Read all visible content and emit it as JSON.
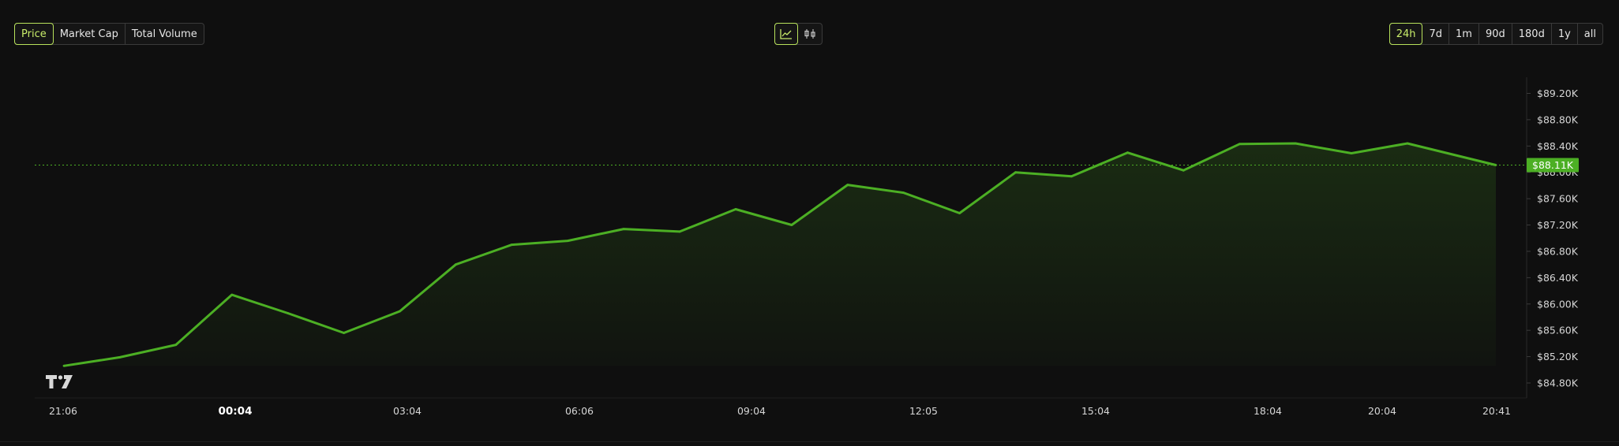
{
  "metric_tabs": {
    "items": [
      "Price",
      "Market Cap",
      "Total Volume"
    ],
    "active": 0
  },
  "chart_type_toggle": {
    "items": [
      "line-chart-icon",
      "candlestick-icon"
    ],
    "active": 0
  },
  "range_tabs": {
    "items": [
      "24h",
      "7d",
      "1m",
      "90d",
      "180d",
      "1y",
      "all"
    ],
    "active": 0
  },
  "colors": {
    "accent": "#b8e25b",
    "line": "#4caf24",
    "current_price_badge": "#4caf24",
    "background": "#0f0f0f"
  },
  "current_price_label": "$88.11K",
  "logo": "TV",
  "chart_data": {
    "type": "area",
    "x_tick_labels": [
      "21:06",
      "00:04",
      "03:04",
      "06:06",
      "09:04",
      "12:05",
      "15:04",
      "18:04",
      "20:04",
      "20:41"
    ],
    "x_tick_bold": [
      false,
      true,
      false,
      false,
      false,
      false,
      false,
      false,
      false,
      false
    ],
    "y_tick_labels": [
      "$89.20K",
      "$88.80K",
      "$88.40K",
      "$88.00K",
      "$87.60K",
      "$87.20K",
      "$86.80K",
      "$86.40K",
      "$86.00K",
      "$85.60K",
      "$85.20K",
      "$84.80K"
    ],
    "y_ticks": [
      89200,
      88800,
      88400,
      88000,
      87600,
      87200,
      86800,
      86400,
      86000,
      85600,
      85200,
      84800
    ],
    "ylim": [
      84800,
      89200
    ],
    "x_hours": [
      0,
      1,
      2,
      3,
      4,
      5,
      6,
      7,
      8,
      9,
      10,
      11,
      12,
      13,
      14,
      15,
      16,
      17,
      18,
      19,
      20,
      21,
      22,
      23,
      24,
      25,
      25.58
    ],
    "values": [
      85060,
      85190,
      85380,
      86140,
      85860,
      85560,
      85890,
      86600,
      86900,
      86960,
      87140,
      87100,
      87440,
      87200,
      87810,
      87690,
      87380,
      88000,
      87940,
      88300,
      88030,
      88430,
      88440,
      88290,
      88440,
      88110
    ],
    "current_price": 88110,
    "xlabel": "",
    "ylabel": "",
    "grid": false
  }
}
